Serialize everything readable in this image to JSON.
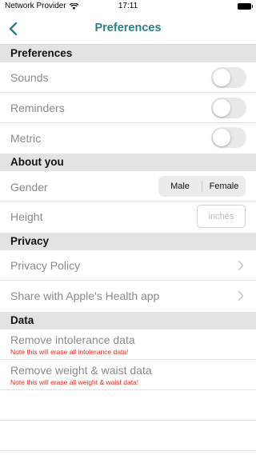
{
  "status_bar": {
    "carrier": "Network Provider",
    "time": "17:11"
  },
  "nav": {
    "title": "Preferences"
  },
  "sections": {
    "preferences": {
      "header": "Preferences",
      "sounds": {
        "label": "Sounds",
        "on": false
      },
      "reminders": {
        "label": "Reminders",
        "on": false
      },
      "metric": {
        "label": "Metric",
        "on": false
      }
    },
    "about_you": {
      "header": "About you",
      "gender": {
        "label": "Gender",
        "options": [
          "Male",
          "Female"
        ]
      },
      "height": {
        "label": "Height",
        "value": "",
        "placeholder": "inches"
      }
    },
    "privacy": {
      "header": "Privacy",
      "policy": {
        "label": "Privacy Policy"
      },
      "health": {
        "label": "Share with Apple's Health app"
      }
    },
    "data": {
      "header": "Data",
      "intolerance": {
        "label": "Remove intolerance data",
        "note": "Note this will erase all intolerance data!"
      },
      "weight": {
        "label": "Remove weight & waist data",
        "note": "Note this will erase all weight & waist data!"
      }
    }
  },
  "colors": {
    "accent": "#2f7d85",
    "warning": "#e0281b",
    "section_bg": "#e3e3e3",
    "toggle_off": "#e9e9ea"
  }
}
